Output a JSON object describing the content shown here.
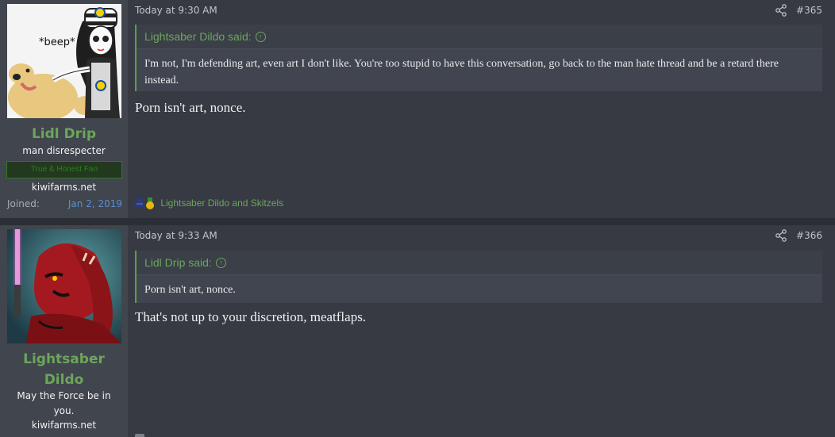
{
  "posts": [
    {
      "user": {
        "name": "Lidl Drip",
        "title": "man disrespecter",
        "banner": "True & Honest Fan",
        "site": "kiwifarms.net",
        "joined_label": "Joined:",
        "joined_date": "Jan 2, 2019",
        "avatar_caption": "*beep*"
      },
      "time": "Today at 9:30 AM",
      "number": "#365",
      "quote": {
        "author_said": "Lightsaber Dildo said:",
        "text": "I'm not, I'm defending art, even art I don't like. You're too stupid to have this conversation, go back to the man hate thread and be a retard there instead."
      },
      "body": "Porn isn't art, nonce.",
      "reactions": "Lightsaber Dildo and Skitzels"
    },
    {
      "user": {
        "name": "Lightsaber Dildo",
        "title": "May the Force be in you.",
        "site": "kiwifarms.net"
      },
      "time": "Today at 9:33 AM",
      "number": "#366",
      "quote": {
        "author_said": "Lidl Drip said:",
        "text": "Porn isn't art, nonce."
      },
      "body": "That's not up to your discretion, meatflaps."
    }
  ],
  "colors": {
    "accent_green": "#6ba65a",
    "link_blue": "#5a8fd4",
    "post_bg": "#373a43",
    "user_bg": "#41454d"
  }
}
